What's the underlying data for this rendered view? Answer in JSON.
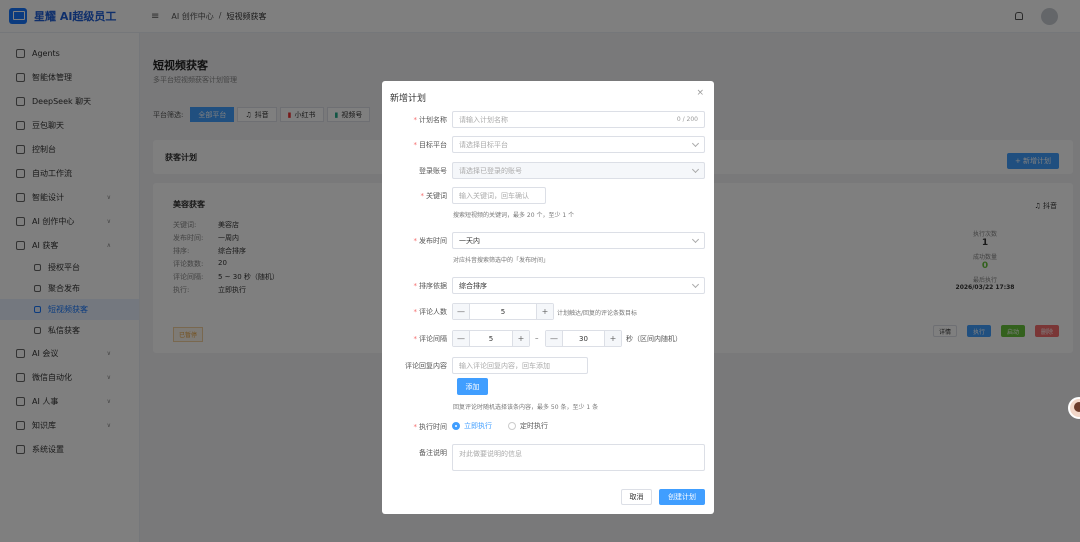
{
  "app": {
    "title": "星耀 AI超级员工"
  },
  "breadcrumb": [
    "AI 创作中心",
    "/",
    "短视频获客"
  ],
  "sidebar": {
    "items": [
      {
        "label": "Agents"
      },
      {
        "label": "智能体管理"
      },
      {
        "label": "DeepSeek 聊天"
      },
      {
        "label": "豆包聊天"
      },
      {
        "label": "控制台"
      },
      {
        "label": "自动工作流"
      },
      {
        "label": "智能设计"
      },
      {
        "label": "AI 创作中心"
      },
      {
        "label": "AI 获客"
      },
      {
        "label": "授权平台"
      },
      {
        "label": "聚合发布"
      },
      {
        "label": "短视频获客"
      },
      {
        "label": "私信获客"
      },
      {
        "label": "AI 会议"
      },
      {
        "label": "微信自动化"
      },
      {
        "label": "AI 人事"
      },
      {
        "label": "知识库"
      },
      {
        "label": "系统设置"
      }
    ]
  },
  "page": {
    "title": "短视频获客",
    "subtitle": "多平台短视频获客计划管理",
    "filter_label": "平台筛选:",
    "chips": [
      "全部平台",
      "抖音",
      "小红书",
      "视频号"
    ],
    "list_title": "获客计划",
    "new_button": "+ 新增计划"
  },
  "plan": {
    "name": "美容获客",
    "platform": "抖音",
    "rows": [
      {
        "k": "关键词:",
        "v": "美容店"
      },
      {
        "k": "发布时间:",
        "v": "一周内"
      },
      {
        "k": "排序:",
        "v": "综合排序"
      },
      {
        "k": "评论数数:",
        "v": "20"
      },
      {
        "k": "评论间隔:",
        "v": "5 ~ 30 秒（随机）"
      },
      {
        "k": "执行:",
        "v": "立即执行"
      }
    ],
    "tag": "已暂停",
    "stats": {
      "exec_label": "执行次数",
      "exec_value": "1",
      "success_label": "成功数量",
      "success_value": "0",
      "last_label": "最后执行",
      "last_value": "2026/03/22 17:38"
    },
    "buttons": [
      "详情",
      "执行",
      "启动",
      "删除"
    ]
  },
  "dialog": {
    "title": "新增计划",
    "close": "×",
    "plan_name": {
      "label": "计划名称",
      "placeholder": "请输入计划名称",
      "count": "0 / 200"
    },
    "platform": {
      "label": "目标平台",
      "placeholder": "请选择目标平台"
    },
    "account": {
      "label": "登录账号",
      "placeholder": "请选择已登录的账号"
    },
    "keyword": {
      "label": "关键词",
      "placeholder": "输入关键词，回车确认",
      "hint": "搜索短视频的关键词，最多 20 个，至少 1 个"
    },
    "publish_time": {
      "label": "发布时间",
      "value": "一天内",
      "hint": "对应抖音搜索筛选中的「发布时间」"
    },
    "sort": {
      "label": "排序依据",
      "value": "综合排序"
    },
    "comment_count": {
      "label": "评论人数",
      "value": "5",
      "hint": "计划触达/回复的评论条数目标"
    },
    "interval": {
      "label": "评论间隔",
      "min": "5",
      "max": "30",
      "separator": "–",
      "unit": "秒（区间内随机）"
    },
    "reply": {
      "label": "评论回复内容",
      "placeholder": "输入评论回复内容，回车添加",
      "add": "添加",
      "hint": "回复评论时随机选择该条内容，最多 50 条，至少 1 条"
    },
    "exec_time": {
      "label": "执行时间",
      "option_now": "立即执行",
      "option_scheduled": "定时执行"
    },
    "note": {
      "label": "备注说明",
      "placeholder": "对此做要说明的信息"
    },
    "cancel": "取消",
    "submit": "创建计划"
  }
}
